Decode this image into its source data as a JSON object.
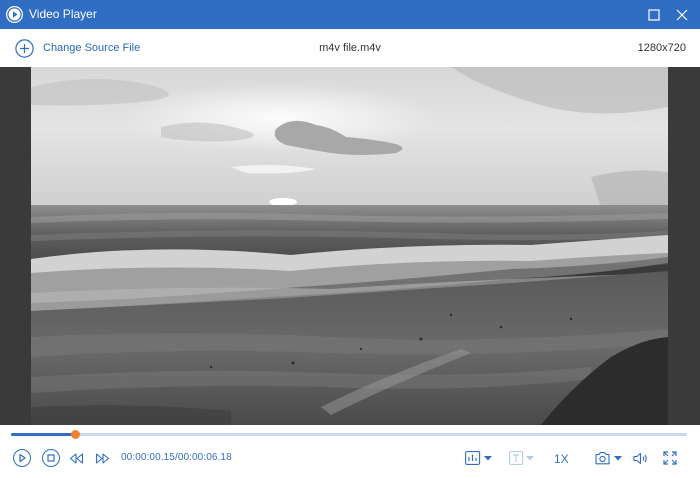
{
  "window": {
    "title": "Video Player"
  },
  "toolbar": {
    "change_source_label": "Change Source File",
    "filename": "m4v file.m4v",
    "resolution": "1280x720"
  },
  "playback": {
    "current_time": "00:00:00.15",
    "total_time": "/00:00:06.18",
    "speed_label": "1X",
    "progress_fraction": 0.094
  },
  "icons": {
    "app": "play-circle-icon",
    "maximize": "maximize-icon",
    "close": "close-icon",
    "change_source": "plus-circle-icon",
    "play": "play-icon",
    "stop": "stop-icon",
    "previous_frame": "previous-frame-icon",
    "next_frame": "next-frame-icon",
    "audio_track": "audio-track-icon",
    "subtitle": "subtitle-icon",
    "snapshot": "camera-icon",
    "volume": "volume-icon",
    "fullscreen": "fullscreen-icon"
  },
  "colors": {
    "accent": "#2f6ec2",
    "progress_thumb": "#f0822d",
    "stage_background": "#3a3a3a"
  }
}
